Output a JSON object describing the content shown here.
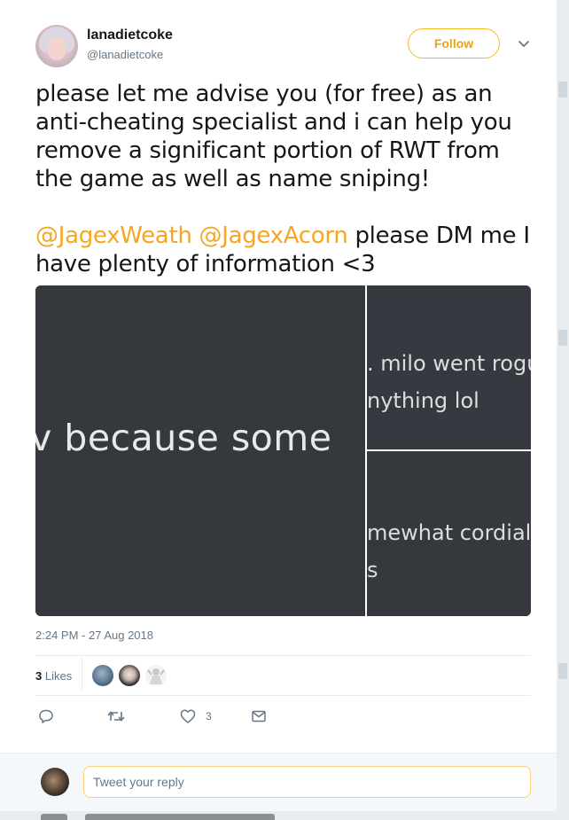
{
  "author": {
    "display_name": "lanadietcoke",
    "handle": "@lanadietcoke"
  },
  "follow_label": "Follow",
  "tweet": {
    "text_line_1": "please let me advise you (for free) as an anti-cheating specialist and i can help you remove a significant portion of RWT from the game as well as name sniping!",
    "mention_1": "@JagexWeath",
    "mention_2": "@JagexAcorn",
    "text_line_2": "please DM me I have plenty of information <3"
  },
  "media": {
    "left_text": "v because some",
    "top_right_line_1": ". milo went rogu",
    "top_right_line_2": "nything lol",
    "bottom_right_line_1": "mewhat cordial",
    "bottom_right_line_2": "s"
  },
  "timestamp": "2:24 PM - 27 Aug 2018",
  "likes": {
    "count": "3",
    "label": "Likes"
  },
  "actions": {
    "like_count": "3"
  },
  "reply_placeholder": "Tweet your reply",
  "colors": {
    "accent": "#f5a623",
    "follow_border": "#f5b921",
    "meta_gray": "#657786"
  },
  "icons": [
    "chevron-down-icon",
    "reply-icon",
    "retweet-icon",
    "heart-icon",
    "envelope-icon"
  ]
}
